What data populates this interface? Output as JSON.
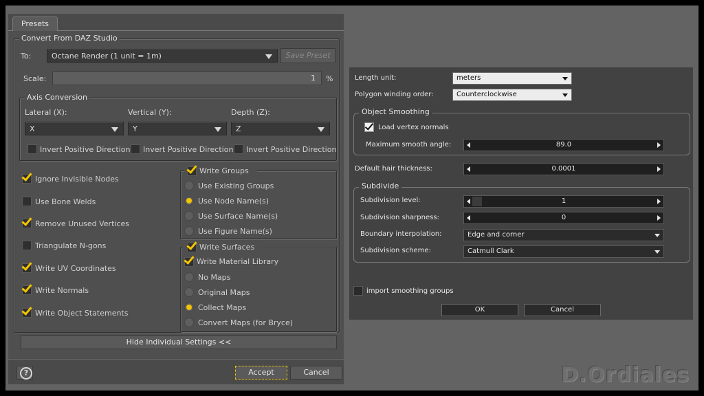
{
  "left_dialog": {
    "tab": "Presets",
    "group_title": "Convert From DAZ Studio",
    "to_label": "To:",
    "to_value": "Octane Render (1 unit = 1m)",
    "save_preset": "Save Preset",
    "scale_label": "Scale:",
    "scale_value": "1",
    "scale_unit": "%",
    "axis": {
      "title": "Axis Conversion",
      "lateral_label": "Lateral (X):",
      "vertical_label": "Vertical (Y):",
      "depth_label": "Depth (Z):",
      "lateral_value": "X",
      "vertical_value": "Y",
      "depth_value": "Z",
      "invert_label": "Invert Positive Direction"
    },
    "options": [
      {
        "label": "Ignore Invisible Nodes",
        "checked": true
      },
      {
        "label": "Use Bone Welds",
        "checked": false
      },
      {
        "label": "Remove Unused Vertices",
        "checked": true
      },
      {
        "label": "Triangulate N-gons",
        "checked": false
      },
      {
        "label": "Write UV Coordinates",
        "checked": true
      },
      {
        "label": "Write Normals",
        "checked": true
      },
      {
        "label": "Write Object Statements",
        "checked": true
      }
    ],
    "write_groups": {
      "title": "Write Groups",
      "items": [
        "Use Existing Groups",
        "Use Node Name(s)",
        "Use Surface Name(s)",
        "Use Figure Name(s)"
      ],
      "selected": 1
    },
    "write_surfaces": {
      "title": "Write Surfaces",
      "material_library": "Write Material Library",
      "items": [
        "No Maps",
        "Original Maps",
        "Collect Maps",
        "Convert Maps (for Bryce)"
      ],
      "selected": 2
    },
    "hide_settings": "Hide Individual Settings <<",
    "help": "?",
    "accept": "Accept",
    "cancel": "Cancel"
  },
  "right_dialog": {
    "length_unit_label": "Length unit:",
    "length_unit_value": "meters",
    "winding_label": "Polygon winding order:",
    "winding_value": "Counterclockwise",
    "smoothing": {
      "title": "Object Smoothing",
      "load_normals": "Load vertex normals",
      "max_angle_label": "Maximum smooth angle:",
      "max_angle_value": "89.0"
    },
    "hair_label": "Default hair thickness:",
    "hair_value": "0.0001",
    "subdivide": {
      "title": "Subdivide",
      "level_label": "Subdivision level:",
      "level_value": "1",
      "sharpness_label": "Subdivision sharpness:",
      "sharpness_value": "0",
      "boundary_label": "Boundary interpolation:",
      "boundary_value": "Edge and corner",
      "scheme_label": "Subdivision scheme:",
      "scheme_value": "Catmull Clark"
    },
    "smoothing_groups": "import smoothing groups",
    "ok": "OK",
    "cancel": "Cancel"
  },
  "watermark": "D.Ordiales"
}
